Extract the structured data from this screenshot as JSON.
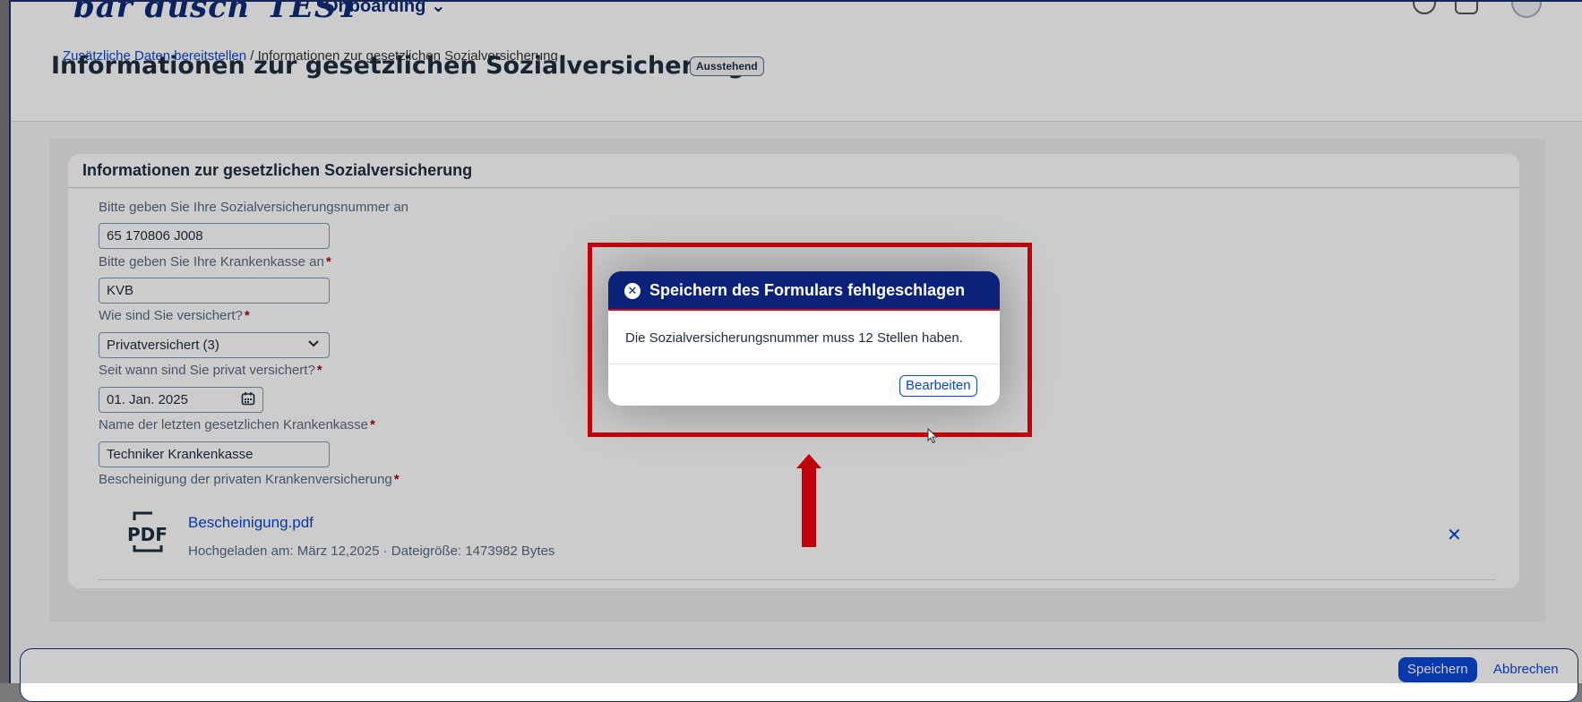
{
  "shell": {
    "logo_text": "bar dusch",
    "logo_suffix": "TEST",
    "app_menu": "Onboarding ⌄"
  },
  "header": {
    "breadcrumb_link": "Zusätzliche Daten bereitstellen",
    "breadcrumb_separator": " / ",
    "breadcrumb_current": "Informationen zur gesetzlichen Sozialversicherung",
    "title": "Informationen zur gesetzlichen Sozialversicherung",
    "status": "Ausstehend"
  },
  "form": {
    "section_title": "Informationen zur gesetzlichen Sozialversicherung",
    "fields": [
      {
        "label": "Bitte geben Sie Ihre Sozialversicherungsnummer an",
        "required": false,
        "value": "65 170806 J008"
      },
      {
        "label": "Bitte geben Sie Ihre Krankenkasse an",
        "required": true,
        "value": "KVB"
      },
      {
        "label": "Wie sind Sie versichert?",
        "required": true,
        "value": "Privatversichert (3)"
      },
      {
        "label": "Seit wann sind Sie privat versichert?",
        "required": true,
        "value": "01. Jan. 2025"
      },
      {
        "label": "Name der letzten gesetzlichen Krankenkasse",
        "required": true,
        "value": "Techniker Krankenkasse"
      },
      {
        "label": "Bescheinigung der privaten Krankenversicherung",
        "required": true
      }
    ],
    "required_marker": "*",
    "attachment": {
      "icon_text": "PDF",
      "file_name": "Bescheinigung.pdf",
      "meta": "Hochgeladen am: März 12,2025 · Dateigröße: 1473982 Bytes",
      "delete_symbol": "✕"
    }
  },
  "footer": {
    "save_label": "Speichern",
    "cancel_label": "Abbrechen"
  },
  "dialog": {
    "title": "Speichern des Formulars fehlgeschlagen",
    "icon": "error-icon",
    "icon_glyph": "✕",
    "message": "Die Sozialversicherungsnummer muss 12 Stellen haben.",
    "edit_label": "Bearbeiten"
  },
  "colors": {
    "brand_blue": "#0b2279",
    "link_blue": "#0a47d6",
    "error_red": "#d20a11",
    "annotation_red": "#c0000a"
  }
}
